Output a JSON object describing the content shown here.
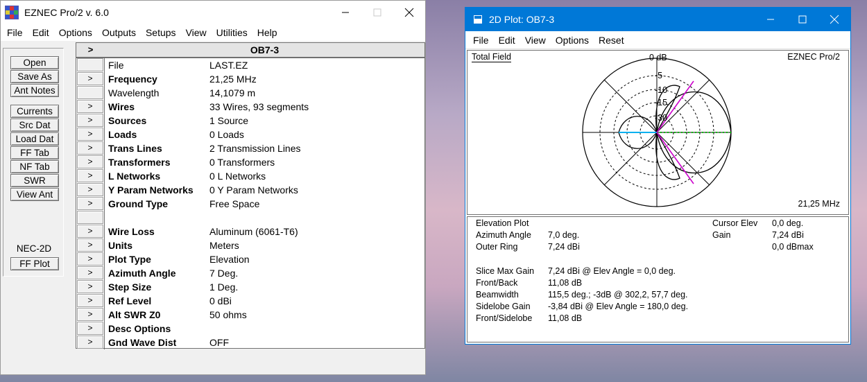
{
  "main_window": {
    "title": "EZNEC Pro/2  v. 6.0",
    "menu": [
      "File",
      "Edit",
      "Options",
      "Outputs",
      "Setups",
      "View",
      "Utilities",
      "Help"
    ]
  },
  "left_buttons": {
    "open": "Open",
    "save_as": "Save As",
    "ant_notes": "Ant Notes",
    "currents": "Currents",
    "src_dat": "Src Dat",
    "load_dat": "Load Dat",
    "ff_tab": "FF Tab",
    "nf_tab": "NF Tab",
    "swr": "SWR",
    "view_ant": "View Ant",
    "engine_label": "NEC-2D",
    "ff_plot": "FF Plot"
  },
  "grid": {
    "header_arrow": ">",
    "header_title": "OB7-3",
    "row_button": ">",
    "rows": [
      {
        "label": "File",
        "bold": false,
        "button": false,
        "value": "LAST.EZ"
      },
      {
        "label": "Frequency",
        "bold": true,
        "button": true,
        "value": "21,25 MHz"
      },
      {
        "label": "Wavelength",
        "bold": false,
        "button": false,
        "value": "14,1079 m"
      },
      {
        "label": "Wires",
        "bold": true,
        "button": true,
        "value": "33 Wires, 93 segments"
      },
      {
        "label": "Sources",
        "bold": true,
        "button": true,
        "value": "1 Source"
      },
      {
        "label": "Loads",
        "bold": true,
        "button": true,
        "value": "0 Loads"
      },
      {
        "label": "Trans Lines",
        "bold": true,
        "button": true,
        "value": "2 Transmission Lines"
      },
      {
        "label": "Transformers",
        "bold": true,
        "button": true,
        "value": "0 Transformers"
      },
      {
        "label": "L Networks",
        "bold": true,
        "button": true,
        "value": "0 L Networks"
      },
      {
        "label": "Y Param Networks",
        "bold": true,
        "button": true,
        "value": "0 Y Param Networks"
      },
      {
        "label": "Ground Type",
        "bold": true,
        "button": true,
        "value": "Free Space"
      },
      {
        "label": "",
        "bold": false,
        "button": false,
        "value": ""
      },
      {
        "label": "Wire Loss",
        "bold": true,
        "button": true,
        "value": "Aluminum (6061-T6)"
      },
      {
        "label": "Units",
        "bold": true,
        "button": true,
        "value": "Meters"
      },
      {
        "label": "Plot Type",
        "bold": true,
        "button": true,
        "value": "Elevation"
      },
      {
        "label": "Azimuth Angle",
        "bold": true,
        "button": true,
        "value": "7 Deg."
      },
      {
        "label": "Step Size",
        "bold": true,
        "button": true,
        "value": "1 Deg."
      },
      {
        "label": "Ref Level",
        "bold": true,
        "button": true,
        "value": "0 dBi"
      },
      {
        "label": "Alt SWR Z0",
        "bold": true,
        "button": true,
        "value": "50 ohms"
      },
      {
        "label": "Desc Options",
        "bold": true,
        "button": true,
        "value": ""
      },
      {
        "label": "Gnd Wave Dist",
        "bold": true,
        "button": true,
        "value": "OFF"
      }
    ]
  },
  "plot_window": {
    "title": "2D Plot: OB7-3",
    "menu": [
      "File",
      "Edit",
      "View",
      "Options",
      "Reset"
    ],
    "field_label": "Total Field",
    "brand": "EZNEC Pro/2",
    "frequency": "21,25 MHz",
    "ring_labels": [
      "0 dB",
      "-5",
      "-10",
      "-15",
      "-30"
    ],
    "colors": {
      "pattern": "#000000",
      "slice": "#00c000",
      "cursor": "#cc00cc",
      "back": "#00b0f0"
    },
    "info": {
      "plot_type": "Elevation Plot",
      "azimuth_label": "Azimuth Angle",
      "azimuth_value": "7,0 deg.",
      "outer_ring_label": "Outer Ring",
      "outer_ring_value": "7,24 dBi",
      "cursor_elev_label": "Cursor Elev",
      "cursor_elev_value": "0,0 deg.",
      "gain_label": "Gain",
      "gain_value": "7,24 dBi",
      "gain_max": "0,0 dBmax",
      "slice_max_label": "Slice Max Gain",
      "slice_max_value": "7,24 dBi @ Elev Angle = 0,0 deg.",
      "front_back_label": "Front/Back",
      "front_back_value": "11,08 dB",
      "beamwidth_label": "Beamwidth",
      "beamwidth_value": "115,5 deg.; -3dB @ 302,2, 57,7 deg.",
      "sidelobe_label": "Sidelobe Gain",
      "sidelobe_value": "-3,84 dBi @ Elev Angle = 180,0 deg.",
      "front_side_label": "Front/Sidelobe",
      "front_side_value": "11,08 dB"
    }
  }
}
